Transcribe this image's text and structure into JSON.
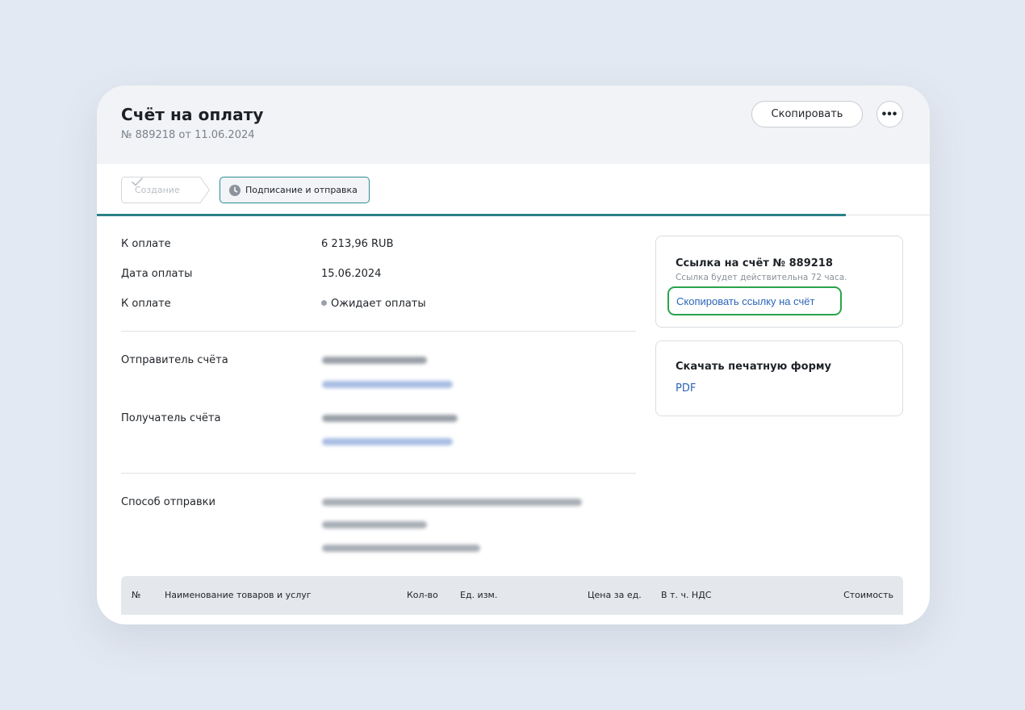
{
  "header": {
    "title": "Счёт на оплату",
    "subtitle": "№ 889218 от 11.06.2024",
    "copy_button": "Скопировать",
    "more_button": "•••"
  },
  "steps": [
    {
      "label": "Создание",
      "state": "done",
      "icon": "check-icon"
    },
    {
      "label": "Подписание и отправка",
      "state": "active",
      "icon": "clock-icon"
    }
  ],
  "summary": {
    "amount_label": "К оплате",
    "amount_value": "6 213,96 RUB",
    "date_label": "Дата оплаты",
    "date_value": "15.06.2024",
    "status_label": "К оплате",
    "status_value": "Ожидает оплаты"
  },
  "parties": {
    "sender_label": "Отправитель счёта",
    "recipient_label": "Получатель счёта",
    "delivery_label": "Способ отправки"
  },
  "link_card": {
    "title": "Ссылка на счёт № 889218",
    "note": "Ссылка будет действительна 72 часа.",
    "copy_link_button": "Скопировать ссылку на счёт"
  },
  "print_card": {
    "title": "Скачать печатную форму",
    "pdf_link": "PDF"
  },
  "table": {
    "columns": [
      "№",
      "Наименование товаров и услуг",
      "Кол-во",
      "Ед. изм.",
      "Цена за ед.",
      "В т. ч. НДС",
      "Стоимость"
    ]
  },
  "colors": {
    "accent_teal": "#2b8088",
    "link_blue": "#2c66b8",
    "highlight_green": "#2aa54b",
    "page_bg": "#e3e9f2"
  }
}
